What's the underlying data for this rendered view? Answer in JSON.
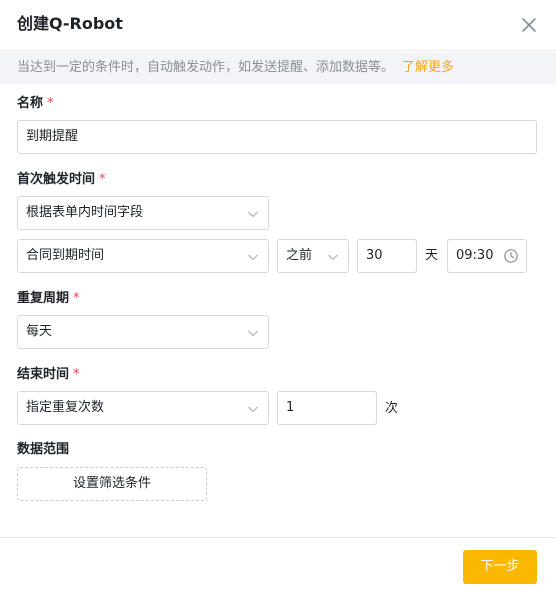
{
  "dialog": {
    "title": "创建Q-Robot",
    "banner_text": "当达到一定的条件时，自动触发动作，如发送提醒、添加数据等。",
    "banner_link": "了解更多"
  },
  "form": {
    "name": {
      "label": "名称",
      "required_mark": "*",
      "value": "到期提醒"
    },
    "first_trigger": {
      "label": "首次触发时间",
      "required_mark": "*",
      "source": "根据表单内时间字段",
      "field": "合同到期时间",
      "relation": "之前",
      "offset": "30",
      "unit": "天",
      "time": "09:30"
    },
    "repeat": {
      "label": "重复周期",
      "required_mark": "*",
      "value": "每天"
    },
    "end": {
      "label": "结束时间",
      "required_mark": "*",
      "mode": "指定重复次数",
      "count": "1",
      "unit": "次"
    },
    "scope": {
      "label": "数据范围",
      "button": "设置筛选条件"
    }
  },
  "footer": {
    "next_label": "下一步"
  },
  "colors": {
    "accent": "#fbb800",
    "link": "#f5a623",
    "required": "#e5484d",
    "banner_bg": "#f3f4f7"
  },
  "icons": {
    "close": "close-icon",
    "dropdown": "chevron-down-icon",
    "time": "clock-icon"
  }
}
